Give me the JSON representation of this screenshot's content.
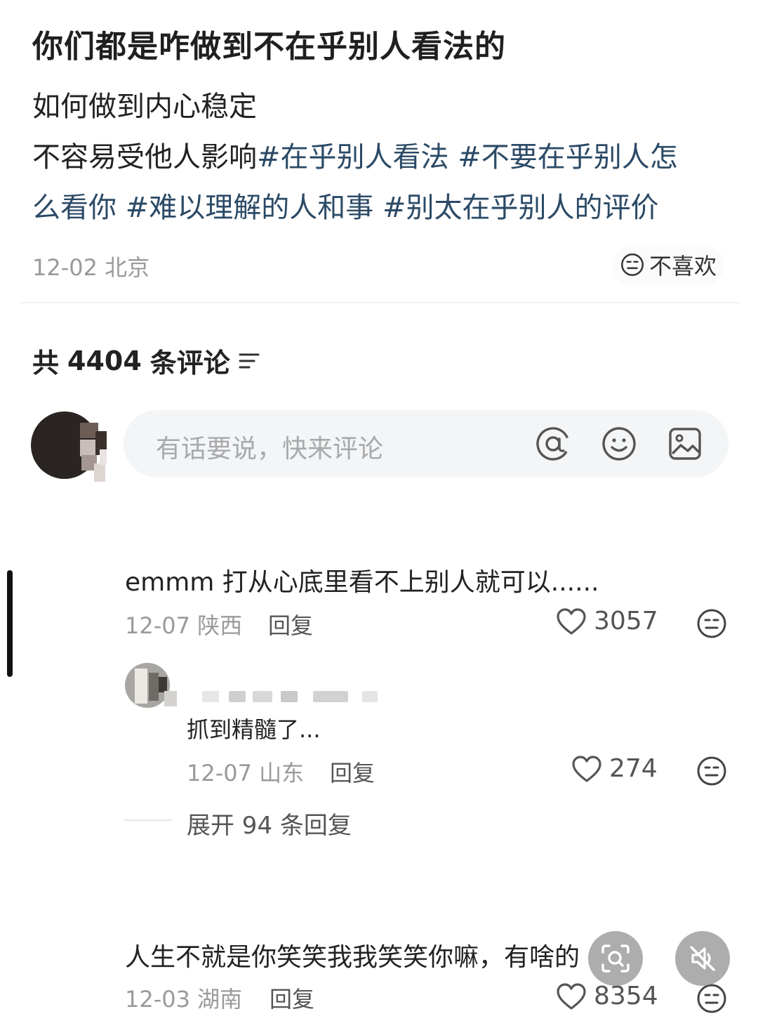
{
  "post": {
    "title": "你们都是咋做到不在乎别人看法的",
    "line1": "如何做到内心稳定",
    "line2_plain": "不容易受他人影响",
    "tags_line2": [
      "#在乎别人看法",
      "#不要在乎别人怎"
    ],
    "line3_plain": "么看你",
    "tags_line3": [
      "#难以理解的人和事",
      "#别太在乎别人的评价"
    ],
    "date": "12-02",
    "location": "北京",
    "dislike_label": "不喜欢"
  },
  "comments_header": {
    "prefix": "共",
    "count": "4404",
    "suffix": "条评论"
  },
  "comment_input": {
    "placeholder": "有话要说，快来评论",
    "icons": [
      "at-icon",
      "emoji-icon",
      "image-icon"
    ]
  },
  "comments": [
    {
      "text": "emmm 打从心底里看不上别人就可以......",
      "date": "12-07",
      "location": "陕西",
      "reply_label": "回复",
      "likes": "3057",
      "sub_reply": {
        "text": "抓到精髓了...",
        "date": "12-07",
        "location": "山东",
        "reply_label": "回复",
        "likes": "274"
      },
      "expand_label": "展开 94 条回复"
    },
    {
      "text": "人生不就是你笑笑我我笑笑你嘛，有啥的",
      "date": "12-03",
      "location": "湖南",
      "reply_label": "回复",
      "likes": "8354"
    }
  ],
  "colors": {
    "tag": "#2b4a66",
    "meta": "#9a9a9a",
    "input_bg": "#f4f5f6"
  }
}
